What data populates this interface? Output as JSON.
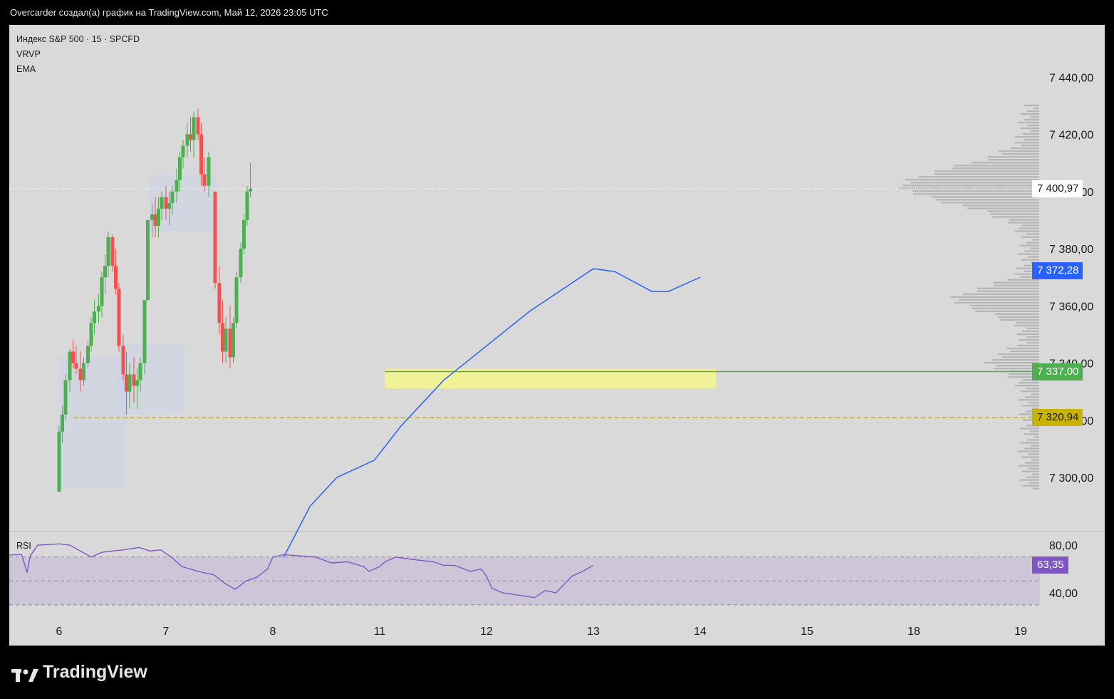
{
  "header": {
    "attribution": "Overcarder создал(а) график на TradingView.com, Май 12, 2026 23:05 UTC"
  },
  "legend": {
    "symbol": "Индекс S&P 500 · 15 · SPCFD",
    "indicator_1": "VRVP",
    "indicator_2": "EMA"
  },
  "rsi_panel": {
    "label": "RSI",
    "current_label": "63,35",
    "current_value": 63.35,
    "upper_band": 70,
    "lower_band": 30,
    "scale_labels": [
      "80,00",
      "40,00"
    ]
  },
  "price_badges": {
    "last": {
      "label": "7 400,97",
      "value": 7400.97,
      "bg": "#ffffff",
      "fg": "#131722"
    },
    "ema": {
      "label": "7 372,28",
      "value": 7372.28,
      "bg": "#2962ff",
      "fg": "#ffffff"
    },
    "level_green": {
      "label": "7 337,00",
      "value": 7337.0,
      "bg": "#4caf50",
      "fg": "#ffffff"
    },
    "level_yellow": {
      "label": "7 320,94",
      "value": 7320.94,
      "bg": "#c8b400",
      "fg": "#131722"
    }
  },
  "brand": {
    "name": "TradingView"
  },
  "colors": {
    "up": "#4caf50",
    "down": "#ef5350",
    "ema": "#2962ff",
    "rsi": "#7e57c2",
    "zone": "#f5f58c",
    "level_green": "#4caf50",
    "level_yellow": "#c8b400"
  },
  "chart_data": {
    "type": "candlestick",
    "symbol": "Индекс S&P 500",
    "timeframe": "15",
    "y_axis": {
      "ticks": [
        7300,
        7320,
        7340,
        7360,
        7380,
        7400,
        7420,
        7440
      ],
      "tick_labels": [
        "7 300,00",
        "7 320,00",
        "7 340,00",
        "7 360,00",
        "7 380,00",
        "7 400,00",
        "7 420,00",
        "7 440,00"
      ],
      "range": [
        7283,
        7456
      ]
    },
    "x_axis": {
      "labels": [
        "6",
        "7",
        "8",
        "11",
        "12",
        "13",
        "14",
        "15",
        "18",
        "19"
      ],
      "session_positions": [
        1,
        2,
        3,
        4,
        5,
        6,
        7,
        8,
        9,
        10
      ]
    },
    "levels": [
      {
        "name": "green line",
        "value": 7337.0
      },
      {
        "name": "yellow dashed",
        "value": 7320.94
      }
    ],
    "zone": {
      "from": 7331,
      "to": 7338,
      "x_start": 3.05,
      "x_end": 6.15
    },
    "volume_profile": "VRVP",
    "ema_points": [
      [
        2.1,
        7272
      ],
      [
        2.35,
        7290
      ],
      [
        2.6,
        7300
      ],
      [
        2.95,
        7306
      ],
      [
        3.2,
        7318
      ],
      [
        3.6,
        7334
      ],
      [
        4.0,
        7346
      ],
      [
        4.4,
        7358
      ],
      [
        4.8,
        7368
      ],
      [
        5.0,
        7373
      ],
      [
        5.2,
        7372
      ],
      [
        5.55,
        7365
      ],
      [
        5.7,
        7365
      ],
      [
        6.0,
        7370
      ]
    ],
    "rsi_points": [
      [
        0.27,
        70
      ],
      [
        0.4,
        71
      ],
      [
        0.6,
        72
      ],
      [
        0.65,
        72
      ],
      [
        0.7,
        57
      ],
      [
        0.73,
        71
      ],
      [
        0.8,
        80
      ],
      [
        1.0,
        81
      ],
      [
        1.1,
        80
      ],
      [
        1.3,
        70
      ],
      [
        1.4,
        74
      ],
      [
        1.6,
        76
      ],
      [
        1.75,
        78
      ],
      [
        1.85,
        75
      ],
      [
        1.95,
        76
      ],
      [
        2.05,
        70
      ],
      [
        2.15,
        62
      ],
      [
        2.3,
        58
      ],
      [
        2.45,
        55
      ],
      [
        2.55,
        48
      ],
      [
        2.65,
        43
      ],
      [
        2.75,
        50
      ],
      [
        2.85,
        53
      ],
      [
        2.95,
        60
      ],
      [
        3.0,
        70
      ],
      [
        3.1,
        72
      ],
      [
        3.25,
        71
      ],
      [
        3.4,
        70
      ],
      [
        3.55,
        65
      ],
      [
        3.7,
        66
      ],
      [
        3.85,
        62
      ],
      [
        3.9,
        58
      ],
      [
        4.0,
        62
      ],
      [
        4.05,
        66
      ],
      [
        4.15,
        70
      ],
      [
        4.3,
        68
      ],
      [
        4.5,
        66
      ],
      [
        4.6,
        63
      ],
      [
        4.7,
        63
      ],
      [
        4.85,
        58
      ],
      [
        4.95,
        60
      ],
      [
        5.0,
        54
      ],
      [
        5.05,
        44
      ],
      [
        5.15,
        40
      ],
      [
        5.3,
        38
      ],
      [
        5.45,
        36
      ],
      [
        5.55,
        42
      ],
      [
        5.65,
        40
      ],
      [
        5.8,
        54
      ],
      [
        5.9,
        58
      ],
      [
        6.0,
        63
      ]
    ],
    "candles_ohlc_by_session_fraction": [
      [
        0.0,
        7295,
        7318,
        7295,
        7316
      ],
      [
        0.03,
        7316,
        7325,
        7312,
        7322
      ],
      [
        0.06,
        7322,
        7336,
        7320,
        7334
      ],
      [
        0.1,
        7334,
        7345,
        7330,
        7344
      ],
      [
        0.13,
        7344,
        7348,
        7338,
        7340
      ],
      [
        0.16,
        7340,
        7346,
        7336,
        7338
      ],
      [
        0.2,
        7338,
        7344,
        7330,
        7334
      ],
      [
        0.23,
        7334,
        7342,
        7332,
        7340
      ],
      [
        0.27,
        7340,
        7348,
        7338,
        7346
      ],
      [
        0.3,
        7346,
        7356,
        7344,
        7354
      ],
      [
        0.33,
        7354,
        7362,
        7350,
        7358
      ],
      [
        0.37,
        7358,
        7364,
        7354,
        7360
      ],
      [
        0.4,
        7360,
        7372,
        7356,
        7370
      ],
      [
        0.43,
        7370,
        7378,
        7364,
        7374
      ],
      [
        0.46,
        7374,
        7386,
        7370,
        7384
      ],
      [
        0.5,
        7384,
        7385,
        7372,
        7374
      ],
      [
        0.53,
        7374,
        7380,
        7364,
        7366
      ],
      [
        0.56,
        7366,
        7368,
        7344,
        7346
      ],
      [
        0.6,
        7346,
        7350,
        7334,
        7336
      ],
      [
        0.63,
        7336,
        7344,
        7322,
        7330
      ],
      [
        0.66,
        7330,
        7340,
        7324,
        7336
      ],
      [
        0.7,
        7336,
        7342,
        7326,
        7332
      ],
      [
        0.73,
        7332,
        7338,
        7324,
        7334
      ],
      [
        0.76,
        7334,
        7342,
        7330,
        7340
      ],
      [
        0.8,
        7340,
        7348,
        7336,
        7362
      ],
      [
        0.83,
        7362,
        7390,
        7362,
        7390
      ],
      [
        0.87,
        7390,
        7396,
        7384,
        7392
      ],
      [
        0.9,
        7392,
        7398,
        7384,
        7388
      ],
      [
        0.93,
        7388,
        7398,
        7384,
        7394
      ],
      [
        0.96,
        7394,
        7400,
        7390,
        7398
      ],
      [
        1.0,
        7398,
        7402,
        7390,
        7394
      ],
      [
        1.03,
        7394,
        7400,
        7388,
        7396
      ],
      [
        1.06,
        7396,
        7402,
        7392,
        7400
      ],
      [
        1.1,
        7400,
        7408,
        7396,
        7404
      ],
      [
        1.13,
        7404,
        7414,
        7400,
        7412
      ],
      [
        1.16,
        7412,
        7418,
        7408,
        7416
      ],
      [
        1.2,
        7416,
        7424,
        7412,
        7420
      ],
      [
        1.23,
        7420,
        7426,
        7414,
        7418
      ],
      [
        1.26,
        7418,
        7428,
        7412,
        7426
      ],
      [
        1.3,
        7426,
        7429,
        7418,
        7420
      ],
      [
        1.33,
        7420,
        7424,
        7402,
        7406
      ],
      [
        1.36,
        7406,
        7412,
        7400,
        7402
      ],
      [
        1.4,
        7402,
        7414,
        7398,
        7412
      ],
      [
        1.46,
        7400,
        7396,
        7366,
        7368
      ],
      [
        1.5,
        7368,
        7374,
        7350,
        7354
      ],
      [
        1.53,
        7354,
        7362,
        7340,
        7344
      ],
      [
        1.56,
        7344,
        7356,
        7340,
        7352
      ],
      [
        1.6,
        7352,
        7360,
        7338,
        7342
      ],
      [
        1.63,
        7342,
        7356,
        7340,
        7354
      ],
      [
        1.66,
        7354,
        7372,
        7352,
        7370
      ],
      [
        1.7,
        7370,
        7382,
        7368,
        7380
      ],
      [
        1.73,
        7380,
        7392,
        7378,
        7390
      ],
      [
        1.76,
        7390,
        7402,
        7388,
        7400
      ],
      [
        1.79,
        7400,
        7410,
        7398,
        7401
      ]
    ]
  }
}
